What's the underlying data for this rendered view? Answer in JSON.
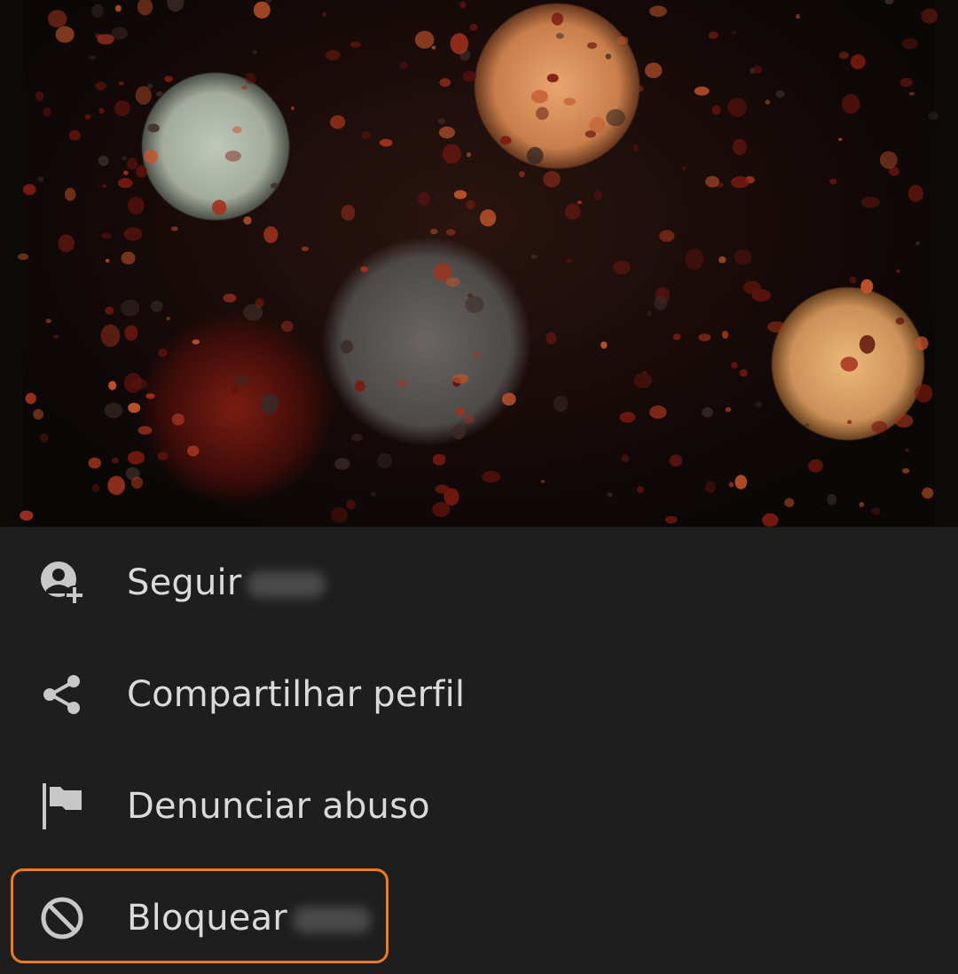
{
  "colors": {
    "sheet_background": "#1e1e1e",
    "menu_text": "#dadada",
    "icon": "#c8c8c8",
    "highlight_border": "#f07a1e"
  },
  "menu": {
    "items": [
      {
        "label": "Seguir",
        "icon": "follow-user-icon",
        "redacted_suffix": true
      },
      {
        "label": "Compartilhar perfil",
        "icon": "share-icon",
        "redacted_suffix": false
      },
      {
        "label": "Denunciar abuso",
        "icon": "flag-icon",
        "redacted_suffix": false
      },
      {
        "label": "Bloquear",
        "icon": "block-icon",
        "redacted_suffix": true
      }
    ],
    "highlighted_item": "Bloquear"
  }
}
